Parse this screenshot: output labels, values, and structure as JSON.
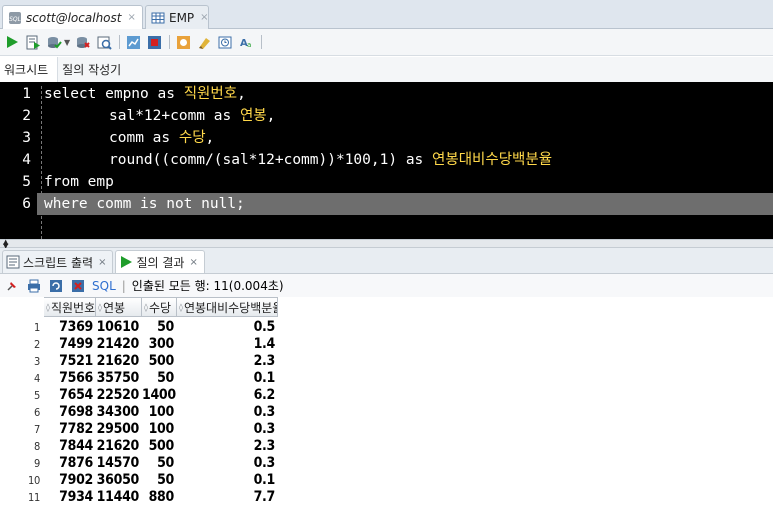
{
  "doc_tabs": [
    {
      "label": "scott@localhost",
      "icon": "sql-worksheet-icon",
      "active": true
    },
    {
      "label": "EMP",
      "icon": "table-grid-icon",
      "active": false
    }
  ],
  "tab_close_glyph": "×",
  "toolbar": {
    "icons": [
      "run-statement-icon",
      "run-script-icon",
      "commit-icon",
      "rollback-icon",
      "explain-plan-icon",
      "autotrace-icon",
      "sql-tuning-icon",
      "unshared-sql-icon",
      "clear-icon",
      "history-icon",
      "format-icon"
    ]
  },
  "subtabs": [
    {
      "label": "워크시트",
      "active": true
    },
    {
      "label": "질의 작성기",
      "active": false
    }
  ],
  "editor": {
    "line_numbers": [
      "1",
      "2",
      "3",
      "4",
      "5",
      "6"
    ],
    "line1": {
      "kw1": "select",
      "ident": " empno ",
      "kw2": "as",
      "alias": " 직원번호",
      "punct": ","
    },
    "line2": {
      "ident": "sal*12+comm ",
      "kw": "as",
      "alias": " 연봉",
      "punct": ","
    },
    "line3": {
      "ident": "comm ",
      "kw": "as",
      "alias": " 수당",
      "punct": ","
    },
    "line4": {
      "ident": "round((comm/(sal*12+comm))*100,1) ",
      "kw": "as",
      "alias": " 연봉대비수당백분율"
    },
    "line5": {
      "kw": "from",
      "ident": " emp"
    },
    "line6": {
      "text": "where comm is not null;"
    }
  },
  "output_tabs": [
    {
      "label": "스크립트 출력",
      "icon": "script-output-icon",
      "active": false
    },
    {
      "label": "질의 결과",
      "icon": "query-result-icon",
      "active": true
    }
  ],
  "result_toolbar": {
    "sql_label": "SQL",
    "separator": "|",
    "status": "인출된 모든 행: 11(0.004초)"
  },
  "grid": {
    "columns": [
      "직원번호",
      "연봉",
      "수당",
      "연봉대비수당백분율"
    ],
    "rows": [
      {
        "n": "1",
        "cells": [
          "7369",
          "10610",
          "50",
          "0.5"
        ]
      },
      {
        "n": "2",
        "cells": [
          "7499",
          "21420",
          "300",
          "1.4"
        ]
      },
      {
        "n": "3",
        "cells": [
          "7521",
          "21620",
          "500",
          "2.3"
        ]
      },
      {
        "n": "4",
        "cells": [
          "7566",
          "35750",
          "50",
          "0.1"
        ]
      },
      {
        "n": "5",
        "cells": [
          "7654",
          "22520",
          "1400",
          "6.2"
        ]
      },
      {
        "n": "6",
        "cells": [
          "7698",
          "34300",
          "100",
          "0.3"
        ]
      },
      {
        "n": "7",
        "cells": [
          "7782",
          "29500",
          "100",
          "0.3"
        ]
      },
      {
        "n": "8",
        "cells": [
          "7844",
          "21620",
          "500",
          "2.3"
        ]
      },
      {
        "n": "9",
        "cells": [
          "7876",
          "14570",
          "50",
          "0.3"
        ]
      },
      {
        "n": "10",
        "cells": [
          "7902",
          "36050",
          "50",
          "0.1"
        ]
      },
      {
        "n": "11",
        "cells": [
          "7934",
          "11440",
          "880",
          "7.7"
        ]
      }
    ]
  }
}
